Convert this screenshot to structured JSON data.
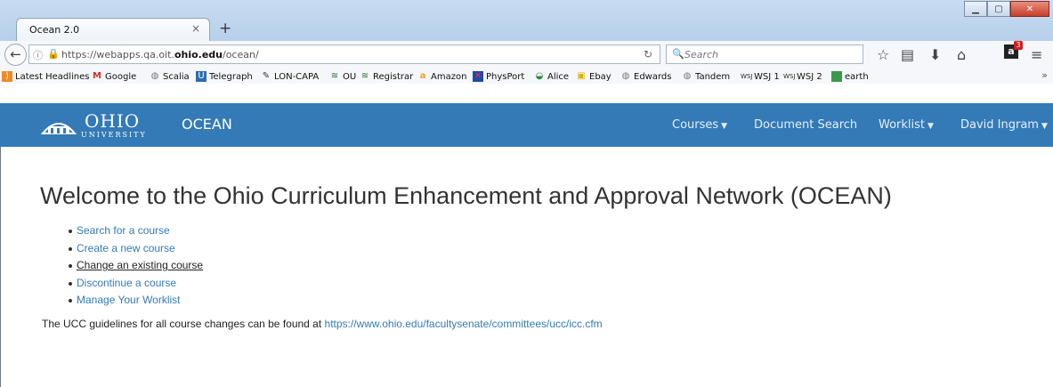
{
  "browser": {
    "tab_title": "Ocean 2.0",
    "tab_close": "×",
    "new_tab": "+",
    "url_prefix": "https://webapps.qa.oit.",
    "url_host": "ohio.edu",
    "url_path": "/ocean/",
    "search_placeholder": "Search",
    "badge_letter": "a",
    "badge_count": "3",
    "bookmarks": [
      {
        "label": "Latest Headlines",
        "icon": "rss-icon",
        "color": "#f08a24"
      },
      {
        "label": "Google",
        "icon": "gmail-icon",
        "color": "#d93025"
      },
      {
        "label": "Scalia",
        "icon": "globe-icon",
        "color": "#777777"
      },
      {
        "label": "Telegraph",
        "icon": "telegraph-icon",
        "color": "#2b6cb0"
      },
      {
        "label": "LON-CAPA",
        "icon": "loncapa-icon",
        "color": "#333333"
      },
      {
        "label": "OU",
        "icon": "ohio-seal-icon",
        "color": "#2f6b3a"
      },
      {
        "label": "Registrar",
        "icon": "ohio-seal-icon",
        "color": "#2f6b3a"
      },
      {
        "label": "Amazon",
        "icon": "amazon-icon",
        "color": "#f0a020"
      },
      {
        "label": "PhysPort",
        "icon": "physport-icon",
        "color": "#1f4aa8"
      },
      {
        "label": "Alice",
        "icon": "alice-icon",
        "color": "#2b8a3e"
      },
      {
        "label": "Ebay",
        "icon": "ebay-icon",
        "color": "#e0b000"
      },
      {
        "label": "Edwards",
        "icon": "globe-icon",
        "color": "#777777"
      },
      {
        "label": "Tandem",
        "icon": "globe-icon",
        "color": "#777777"
      },
      {
        "label": "WSJ 1",
        "icon": "wsj-icon",
        "color": "#222222"
      },
      {
        "label": "WSJ 2",
        "icon": "wsj-icon",
        "color": "#222222"
      },
      {
        "label": "earth",
        "icon": "earth-icon",
        "color": "#3a9a4a"
      }
    ],
    "bookmarks_more": "»"
  },
  "header": {
    "logo_text": "OHIO",
    "logo_subtext": "UNIVERSITY",
    "brand": "OCEAN",
    "nav": {
      "courses": "Courses",
      "document_search": "Document Search",
      "worklist": "Worklist",
      "user": "David Ingram"
    },
    "bg_color": "#337ab7"
  },
  "main": {
    "title": "Welcome to the Ohio Curriculum Enhancement and Approval Network (OCEAN)",
    "links": [
      "Search for a course",
      "Create a new course",
      "Change an existing course",
      "Discontinue a course",
      "Manage Your Worklist"
    ],
    "guideline_text": "The UCC guidelines for all course changes can be found at",
    "guideline_link": "https://www.ohio.edu/facultysenate/committees/ucc/icc.cfm"
  }
}
